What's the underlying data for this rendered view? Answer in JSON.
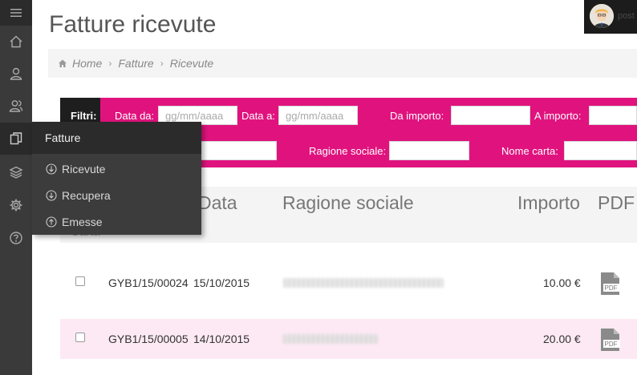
{
  "header": {
    "title": "Fatture ricevute",
    "user_name": "post"
  },
  "breadcrumb": {
    "items": [
      "Home",
      "Fatture",
      "Ricevute"
    ]
  },
  "sidebar": {
    "icons": [
      "menu-icon",
      "home-icon",
      "user-icon",
      "users-icon",
      "documents-icon",
      "layers-icon",
      "gear-icon",
      "help-icon"
    ]
  },
  "flyout": {
    "title": "Fatture",
    "items": [
      {
        "label": "Ricevute",
        "icon": "arrow-down-circle-icon"
      },
      {
        "label": "Recupera",
        "icon": "arrow-down-circle-icon"
      },
      {
        "label": "Emesse",
        "icon": "arrow-up-circle-icon"
      }
    ]
  },
  "filters": {
    "label": "Filtri:",
    "data_da": {
      "label": "Data da:",
      "placeholder": "gg/mm/aaaa",
      "value": ""
    },
    "data_a": {
      "label": "Data a:",
      "placeholder": "gg/mm/aaaa",
      "value": ""
    },
    "da_importo": {
      "label": "Da importo:",
      "value": ""
    },
    "a_importo": {
      "label": "A importo:",
      "value": ""
    },
    "ragione_sociale": {
      "label": "Ragione sociale:",
      "value": ""
    },
    "nome_carta": {
      "label": "Nome carta:",
      "value": ""
    }
  },
  "table": {
    "headers": {
      "data": "Data",
      "ragione_sociale": "Ragione sociale",
      "importo": "Importo",
      "pdf": "PDF",
      "cut": "Carta"
    },
    "rows": [
      {
        "numero": "GYB1/15/00024",
        "data": "15/10/2015",
        "importo": "10.00 €"
      },
      {
        "numero": "GYB1/15/00005",
        "data": "14/10/2015",
        "importo": "20.00 €"
      }
    ]
  },
  "colors": {
    "accent": "#e0137e",
    "sidebar": "#3a3a3a",
    "flyout": "#3c3c3c",
    "row_alt": "#fce9f3"
  }
}
